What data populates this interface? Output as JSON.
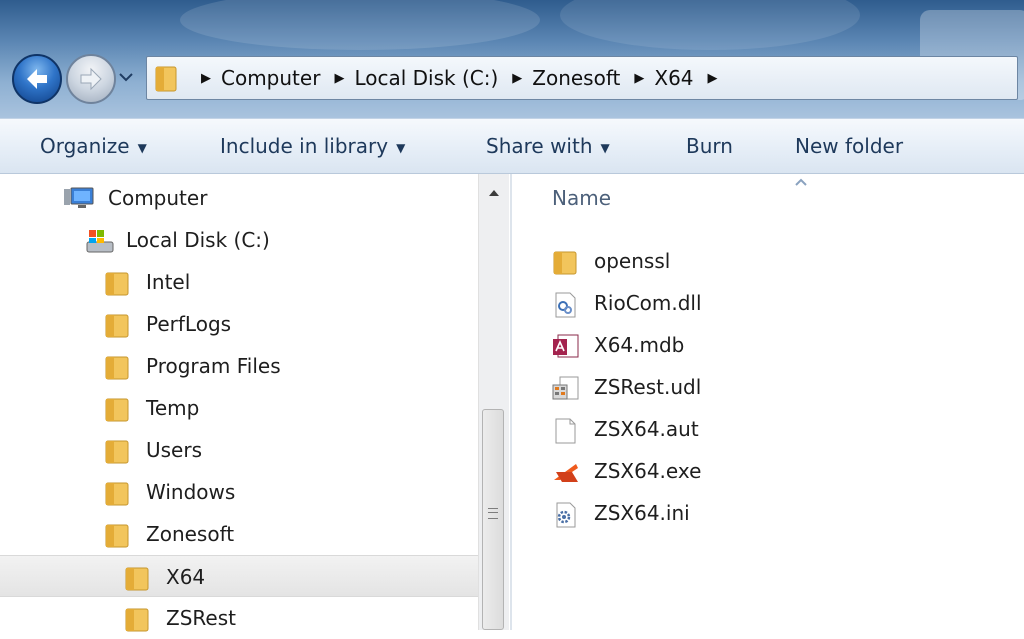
{
  "address": {
    "crumbs": [
      "Computer",
      "Local Disk (C:)",
      "Zonesoft",
      "X64"
    ]
  },
  "toolbar": {
    "organize": "Organize",
    "include_in_library": "Include in library",
    "share_with": "Share with",
    "burn": "Burn",
    "new_folder": "New folder"
  },
  "nav": {
    "items": [
      {
        "label": "Computer",
        "icon": "computer-icon"
      },
      {
        "label": "Local Disk (C:)",
        "icon": "local-disk-icon"
      },
      {
        "label": "Intel",
        "icon": "folder-icon"
      },
      {
        "label": "PerfLogs",
        "icon": "folder-icon"
      },
      {
        "label": "Program Files",
        "icon": "folder-icon"
      },
      {
        "label": "Temp",
        "icon": "folder-icon"
      },
      {
        "label": "Users",
        "icon": "folder-icon"
      },
      {
        "label": "Windows",
        "icon": "folder-icon"
      },
      {
        "label": "Zonesoft",
        "icon": "folder-icon"
      },
      {
        "label": "X64",
        "icon": "folder-icon",
        "selected": true
      },
      {
        "label": "ZSRest",
        "icon": "folder-icon"
      }
    ]
  },
  "content": {
    "column_name": "Name",
    "files": [
      {
        "name": "openssl",
        "icon": "folder-icon"
      },
      {
        "name": "RioCom.dll",
        "icon": "dll-file-icon"
      },
      {
        "name": "X64.mdb",
        "icon": "access-database-icon"
      },
      {
        "name": "ZSRest.udl",
        "icon": "udl-file-icon"
      },
      {
        "name": "ZSX64.aut",
        "icon": "blank-file-icon"
      },
      {
        "name": "ZSX64.exe",
        "icon": "zonesoft-exe-icon"
      },
      {
        "name": "ZSX64.ini",
        "icon": "ini-file-icon"
      }
    ]
  },
  "colors": {
    "folder": "#f2c55c",
    "titlebar": "#5b86b3",
    "selection": "#e4e4e4",
    "command_text": "#1e395b"
  }
}
